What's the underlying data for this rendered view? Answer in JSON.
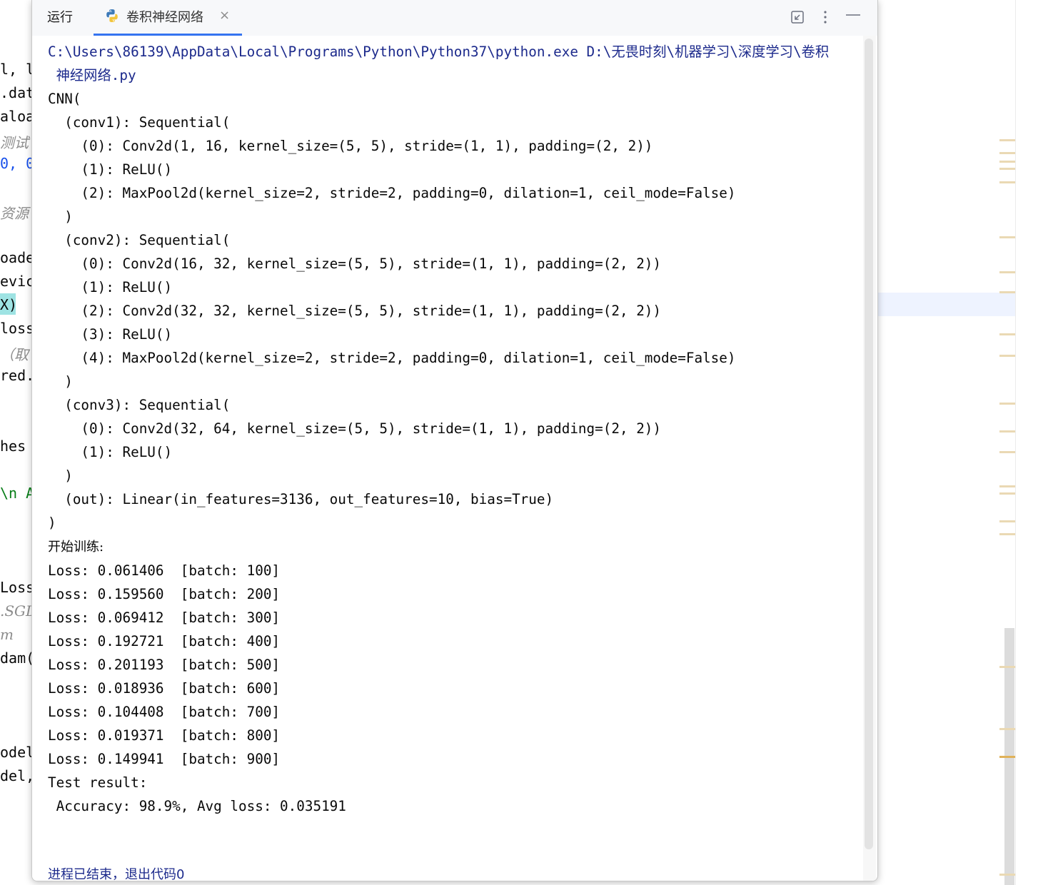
{
  "background_editor": {
    "lines": [
      {
        "text": "l, l"
      },
      {
        "text": ".dat"
      },
      {
        "text": "aloa"
      },
      {
        "text": "测试"
      },
      {
        "text": "0, 0"
      },
      {
        "text": "资源"
      },
      {
        "text": "oade"
      },
      {
        "text": "evic"
      },
      {
        "text": "X)"
      },
      {
        "text": "loss"
      },
      {
        "text": "（取"
      },
      {
        "text": "red."
      },
      {
        "text": "hes"
      },
      {
        "text": "\\n A"
      },
      {
        "text": "Loss"
      },
      {
        "text": ".SGD"
      },
      {
        "text": "m"
      },
      {
        "text": "dam("
      },
      {
        "text": "odel"
      },
      {
        "text": "del,"
      }
    ]
  },
  "run_window": {
    "title": "运行",
    "tab": {
      "label": "卷积神经网络",
      "close_glyph": "×",
      "icon": "python-icon"
    },
    "buttons": {
      "restore": "restore-icon",
      "more": "more-vertical-icon",
      "minimize": "minimize-icon"
    }
  },
  "console": {
    "command_line": "C:\\Users\\86139\\AppData\\Local\\Programs\\Python\\Python37\\python.exe D:\\无畏时刻\\机器学习\\深度学习\\卷积\n 神经网络.py",
    "model_output": "CNN(\n  (conv1): Sequential(\n    (0): Conv2d(1, 16, kernel_size=(5, 5), stride=(1, 1), padding=(2, 2))\n    (1): ReLU()\n    (2): MaxPool2d(kernel_size=2, stride=2, padding=0, dilation=1, ceil_mode=False)\n  )\n  (conv2): Sequential(\n    (0): Conv2d(16, 32, kernel_size=(5, 5), stride=(1, 1), padding=(2, 2))\n    (1): ReLU()\n    (2): Conv2d(32, 32, kernel_size=(5, 5), stride=(1, 1), padding=(2, 2))\n    (3): ReLU()\n    (4): MaxPool2d(kernel_size=2, stride=2, padding=0, dilation=1, ceil_mode=False)\n  )\n  (conv3): Sequential(\n    (0): Conv2d(32, 64, kernel_size=(5, 5), stride=(1, 1), padding=(2, 2))\n    (1): ReLU()\n  )\n  (out): Linear(in_features=3136, out_features=10, bias=True)\n)",
    "train_header": "开始训练:",
    "loss_lines": "Loss: 0.061406  [batch: 100]\nLoss: 0.159560  [batch: 200]\nLoss: 0.069412  [batch: 300]\nLoss: 0.192721  [batch: 400]\nLoss: 0.201193  [batch: 500]\nLoss: 0.018936  [batch: 600]\nLoss: 0.104408  [batch: 700]\nLoss: 0.019371  [batch: 800]\nLoss: 0.149941  [batch: 900]",
    "test_result": "Test result:\n Accuracy: 98.9%, Avg loss: 0.035191",
    "exit_message": "进程已结束，退出代码0"
  },
  "colors": {
    "accent": "#3574f0",
    "command_text": "#1c2a8c",
    "console_text": "#080808"
  }
}
